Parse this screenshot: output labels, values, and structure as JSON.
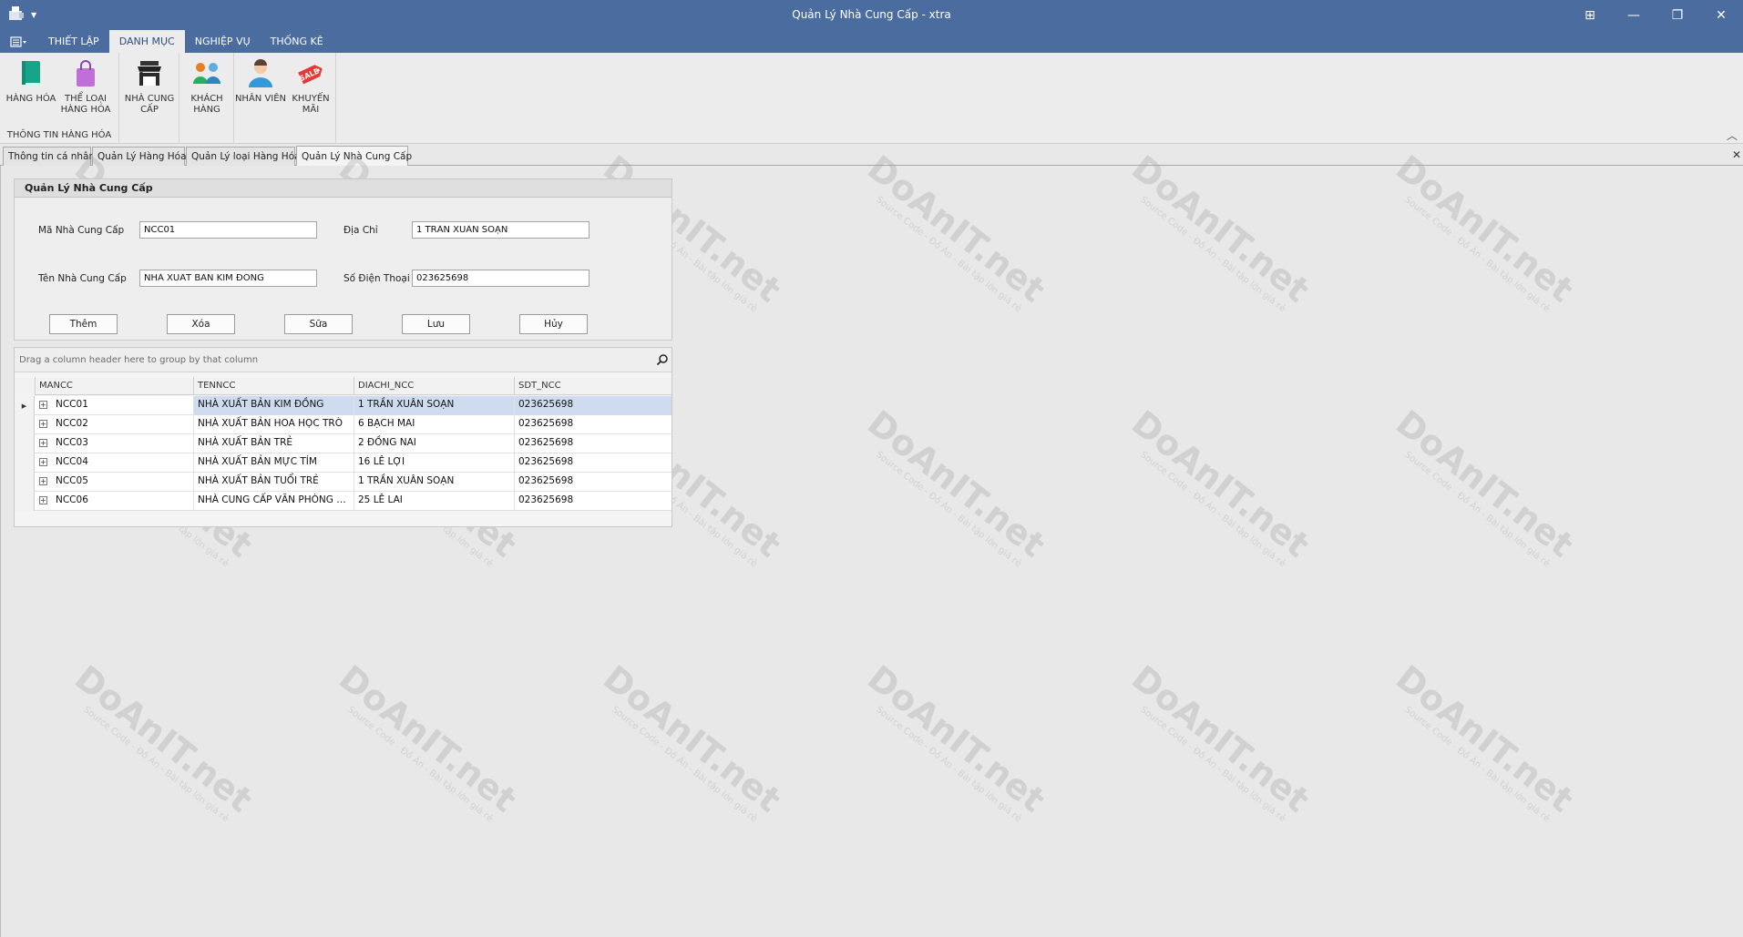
{
  "window": {
    "title": "Quản Lý Nhà Cung Cấp - xtra",
    "controls": [
      "⊞",
      "—",
      "❐",
      "✕"
    ]
  },
  "ribbon": {
    "tabs": [
      {
        "label": "THIẾT LẬP",
        "active": false
      },
      {
        "label": "DANH MỤC",
        "active": true
      },
      {
        "label": "NGHIỆP VỤ",
        "active": false
      },
      {
        "label": "THỐNG KÊ",
        "active": false
      }
    ],
    "group_label": "THÔNG TIN HÀNG HÓA",
    "buttons": [
      {
        "line1": "HÀNG HÓA",
        "line2": "",
        "icon": "book-icon"
      },
      {
        "line1": "THỂ LOẠI",
        "line2": "HÀNG HÓA",
        "icon": "shopping-bag-icon"
      },
      {
        "line1": "NHÀ CUNG",
        "line2": "CẤP",
        "icon": "store-icon"
      },
      {
        "line1": "KHÁCH",
        "line2": "HÀNG",
        "icon": "customers-icon"
      },
      {
        "line1": "NHÂN VIÊN",
        "line2": "",
        "icon": "employee-icon"
      },
      {
        "line1": "KHUYẾN",
        "line2": "MÃI",
        "icon": "sale-tag-icon"
      }
    ],
    "sale_text": "SALE"
  },
  "doc_tabs": [
    {
      "label": "Thông tin cá nhân",
      "active": false
    },
    {
      "label": "Quản Lý Hàng Hóa",
      "active": false
    },
    {
      "label": "Quản Lý loại Hàng Hóa",
      "active": false
    },
    {
      "label": "Quản Lý Nhà Cung Cấp",
      "active": true
    }
  ],
  "form": {
    "title": "Quản Lý Nhà Cung Cấp",
    "ma_label": "Mã Nhà Cung Cấp",
    "ma_value": "NCC01",
    "ten_label": "Tên Nhà Cung Cấp",
    "ten_value": "NHÀ XUẤT BẢN KIM ĐỒNG",
    "diachi_label": "Địa Chỉ",
    "diachi_value": "1 TRẦN XUÂN SOẠN",
    "sdt_label": "Số Điện Thoại",
    "sdt_value": "023625698",
    "buttons": {
      "them": "Thêm",
      "xoa": "Xóa",
      "sua": "Sữa",
      "luu": "Lưu",
      "huy": "Hủy"
    }
  },
  "grid": {
    "group_panel_text": "Drag a column header here to group by that column",
    "columns": [
      "MANCC",
      "TENNCC",
      "DIACHI_NCC",
      "SDT_NCC"
    ],
    "rows": [
      {
        "mancc": "NCC01",
        "tenncc": "NHÀ XUẤT BẢN KIM ĐỒNG",
        "diachi": "1 TRẦN XUÂN SOẠN",
        "sdt": "023625698",
        "selected": true
      },
      {
        "mancc": "NCC02",
        "tenncc": "NHÀ XUẤT BẢN HOA HỌC TRÒ",
        "diachi": "6 BẠCH MAI",
        "sdt": "023625698",
        "selected": false
      },
      {
        "mancc": "NCC03",
        "tenncc": "NHÀ XUẤT BẢN TRẺ",
        "diachi": "2 ĐỒNG NAI",
        "sdt": "023625698",
        "selected": false
      },
      {
        "mancc": "NCC04",
        "tenncc": "NHÀ XUẤT BẢN MỰC TÍM",
        "diachi": "16 LÊ LỢI",
        "sdt": "023625698",
        "selected": false
      },
      {
        "mancc": "NCC05",
        "tenncc": "NHÀ XUẤT BẢN TUỔI TRẺ",
        "diachi": "1 TRẦN XUÂN SOẠN",
        "sdt": "023625698",
        "selected": false
      },
      {
        "mancc": "NCC06",
        "tenncc": "NHÀ CUNG CẤP VĂN PHÒNG PH...",
        "diachi": "25 LÊ LAI",
        "sdt": "023625698",
        "selected": false
      }
    ]
  },
  "watermark": {
    "text": "DoAnIT.net",
    "subtext": "Source Code - Đồ Án - Bài tập lớn giá rẻ"
  },
  "colors": {
    "titlebar": "#4b6c9e",
    "selected_row": "#cfdcf0"
  }
}
